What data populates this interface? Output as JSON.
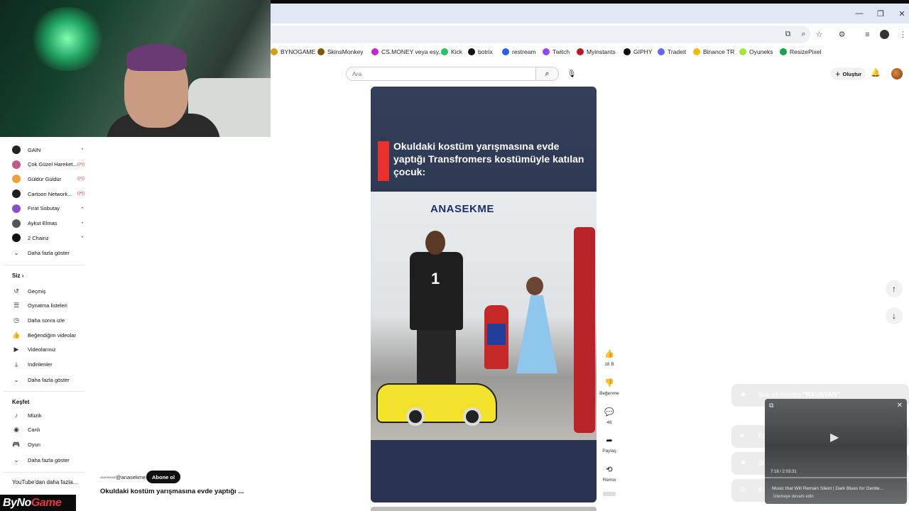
{
  "window": {
    "minimize": "—",
    "restore": "❐",
    "close": "✕"
  },
  "bookmarks": [
    {
      "label": "BYNOGAME",
      "color": "#d4a017"
    },
    {
      "label": "SkinsMonkey",
      "color": "#7a5c00"
    },
    {
      "label": "CS.MONEY veya esy...",
      "color": "#c026d3"
    },
    {
      "label": "Kick",
      "color": "#22c55e"
    },
    {
      "label": "botrix",
      "color": "#111111"
    },
    {
      "label": "restream",
      "color": "#2563eb"
    },
    {
      "label": "Twitch",
      "color": "#9146ff"
    },
    {
      "label": "Myinstants",
      "color": "#b91c1c"
    },
    {
      "label": "GIPHY",
      "color": "#111111"
    },
    {
      "label": "Tradeit",
      "color": "#6366f1"
    },
    {
      "label": "Binance TR",
      "color": "#f0b90b"
    },
    {
      "label": "Oyuneks",
      "color": "#a3e635"
    },
    {
      "label": "ResizePixel",
      "color": "#16a34a"
    }
  ],
  "youtube": {
    "search_placeholder": "Ara",
    "create_label": "Oluştur"
  },
  "sidebar": {
    "subscriptions": [
      {
        "label": "GAİN",
        "color": "#222222",
        "status": "dot"
      },
      {
        "label": "Çok Güzel Hareket...",
        "color": "#c05a8a",
        "status": "live"
      },
      {
        "label": "Güldür Güldür",
        "color": "#f0a23a",
        "status": "live"
      },
      {
        "label": "Cartoon Network...",
        "color": "#1e1e1e",
        "status": "live"
      },
      {
        "label": "Fırat Sobutay",
        "color": "#8a4fc7",
        "status": "dot"
      },
      {
        "label": "Aykut Elmas",
        "color": "#555555",
        "status": "dot"
      },
      {
        "label": "2 Chainz",
        "color": "#111111",
        "status": "dot"
      }
    ],
    "show_more_1": "Daha fazla göster",
    "you_heading": "Siz",
    "you_items": [
      {
        "label": "Geçmiş",
        "icon": "history-icon",
        "glyph": "↺"
      },
      {
        "label": "Oynatma listeleri",
        "icon": "playlist-icon",
        "glyph": "☰"
      },
      {
        "label": "Daha sonra izle",
        "icon": "clock-icon",
        "glyph": "◷"
      },
      {
        "label": "Beğendiğim videolar",
        "icon": "thumbs-up-icon",
        "glyph": "👍"
      },
      {
        "label": "Videolarınız",
        "icon": "video-icon",
        "glyph": "▶"
      },
      {
        "label": "İndirilenler",
        "icon": "download-icon",
        "glyph": "⤓"
      }
    ],
    "show_more_2": "Daha fazla göster",
    "explore_heading": "Keşfet",
    "explore_items": [
      {
        "label": "Müzik",
        "icon": "music-icon",
        "glyph": "♪"
      },
      {
        "label": "Canlı",
        "icon": "live-icon",
        "glyph": "◉"
      },
      {
        "label": "Oyun",
        "icon": "gamepad-icon",
        "glyph": "🎮"
      }
    ],
    "show_more_3": "Daha fazla göster",
    "more_heading": "YouTube'dan daha fazla..."
  },
  "short": {
    "overlay_title": "Okuldaki kostüm yarışmasına evde yaptığı Transfromers kostümüyle katılan çocuk:",
    "watermark": "ANASEKME",
    "jersey_number": "1",
    "channel_logo": "ANASEKME",
    "channel_handle": "@anasekme",
    "subscribe_label": "Abone ol",
    "caption": "Okuldaki kostüm yarışmasına evde yaptığı ..."
  },
  "actions": {
    "like_count": "16 B",
    "dislike_label": "Beğenme",
    "comment_count": "46",
    "share_label": "Paylaş",
    "remix_label": "Remix"
  },
  "stream_overlay": {
    "alerts": [
      {
        "prefix": "Sub x3 months ",
        "name": "\"RAUSYAN\"",
        "icon": "star-icon",
        "glyph": "★"
      },
      {
        "prefix": "Follow ",
        "name": "\"LGF710\"",
        "icon": "heart-icon",
        "glyph": "♥"
      },
      {
        "prefix": "Sub x2 months ",
        "name": "\"BiLoOoOoOo\"",
        "icon": "star-icon",
        "glyph": "★"
      },
      {
        "prefix": "Ki...",
        "name": "",
        "icon": "gift-icon",
        "glyph": "◎"
      }
    ],
    "mini_player": {
      "time": "7:18 / 2:03:31",
      "song": "Music that Will Remain Silent | Dark Blues for Gentle...",
      "continue_label": "İzlemeye devam edin"
    },
    "brand": {
      "part1": "ByNo",
      "part2": "Game"
    }
  }
}
